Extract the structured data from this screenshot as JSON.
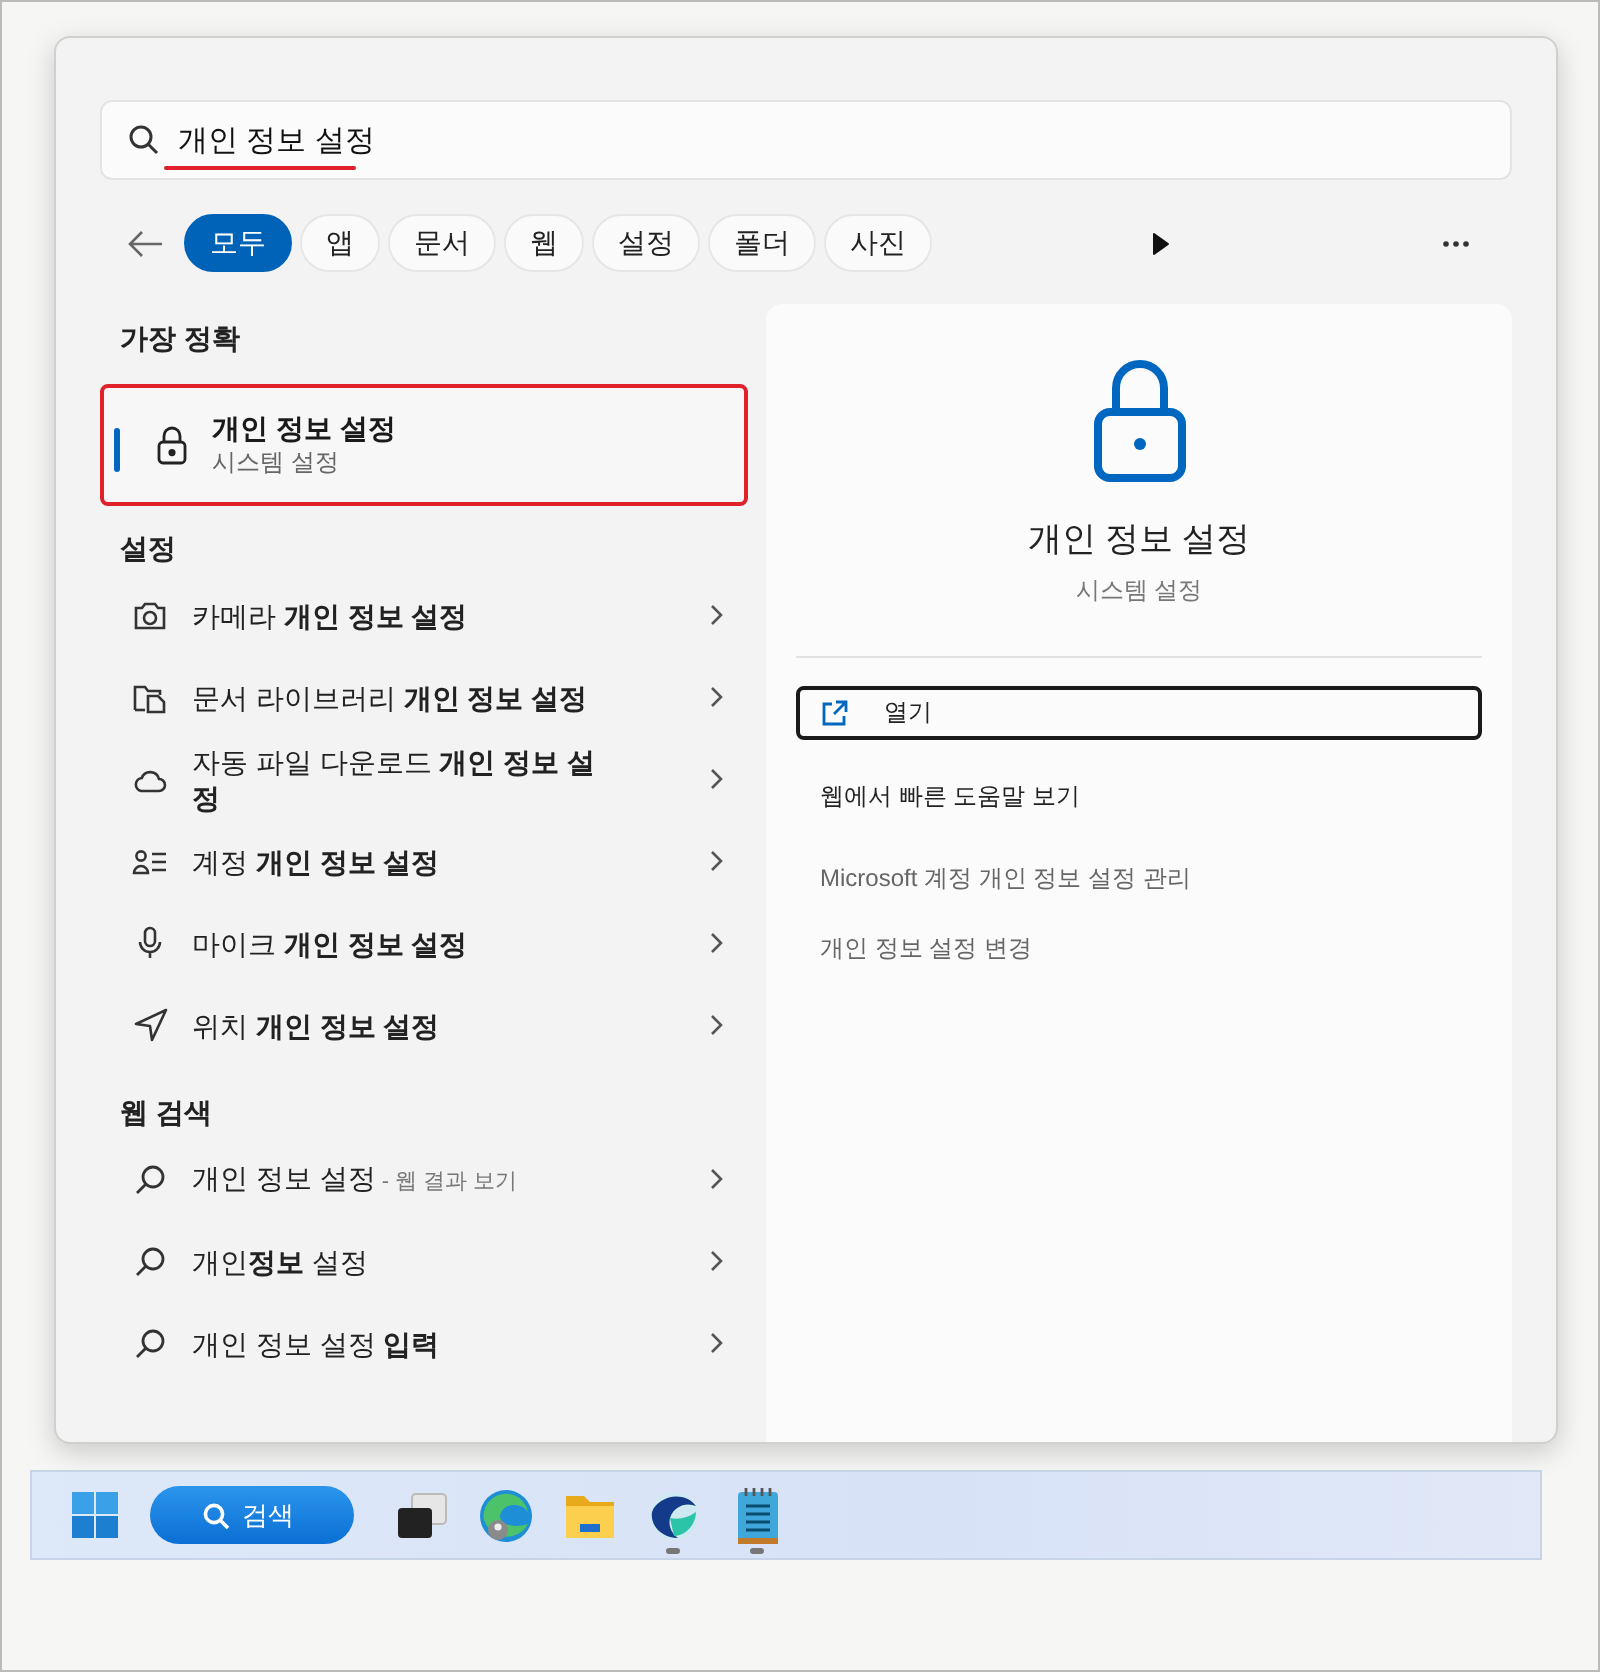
{
  "search": {
    "value": "개인 정보 설정",
    "marked": true
  },
  "filters": [
    {
      "label": "모두",
      "selected": true
    },
    {
      "label": "앱",
      "selected": false
    },
    {
      "label": "문서",
      "selected": false
    },
    {
      "label": "웹",
      "selected": false
    },
    {
      "label": "설정",
      "selected": false
    },
    {
      "label": "폴더",
      "selected": false
    },
    {
      "label": "사진",
      "selected": false
    }
  ],
  "best_match": {
    "heading": "가장 정확",
    "title": "개인 정보 설정",
    "subtitle": "시스템 설정",
    "selected": true,
    "marked": true
  },
  "settings": {
    "heading": "설정",
    "items": [
      {
        "kind": "camera",
        "text": "카메라 **개인 정보 설정**"
      },
      {
        "kind": "library",
        "text": "문서 라이브러리 **개인 정보 설정**"
      },
      {
        "kind": "cloud",
        "text": "자동 파일 다운로드 **개인 정보 설정**"
      },
      {
        "kind": "account",
        "text": "계정 **개인 정보 설정**"
      },
      {
        "kind": "mic",
        "text": "마이크 **개인 정보 설정**"
      },
      {
        "kind": "location",
        "text": "위치 **개인 정보 설정**"
      }
    ]
  },
  "web_search": {
    "heading": "웹 검색",
    "items": [
      {
        "kind": "search",
        "text": "개인 정보 설정",
        "note": "- 웹 결과 보기"
      },
      {
        "kind": "search",
        "text": "개인**정보** 설정"
      },
      {
        "kind": "search",
        "text": "개인 정보 설정 **입력**"
      }
    ]
  },
  "detail": {
    "title": "개인 정보 설정",
    "subtitle": "시스템 설정",
    "actions": [
      {
        "kind": "primary",
        "label": "열기"
      },
      {
        "kind": "heading",
        "label": "웹에서 빠른 도움말 보기"
      },
      {
        "kind": "link",
        "label": "Microsoft 계정 개인 정보 설정 관리"
      },
      {
        "kind": "link",
        "label": "개인 정보 설정 변경"
      }
    ]
  },
  "taskbar": {
    "search_label": "검색",
    "apps": [
      {
        "kind": "task-view",
        "running": false
      },
      {
        "kind": "browser",
        "running": false
      },
      {
        "kind": "folder",
        "running": false
      },
      {
        "kind": "whale",
        "running": true
      },
      {
        "kind": "notepad",
        "running": true
      }
    ]
  }
}
